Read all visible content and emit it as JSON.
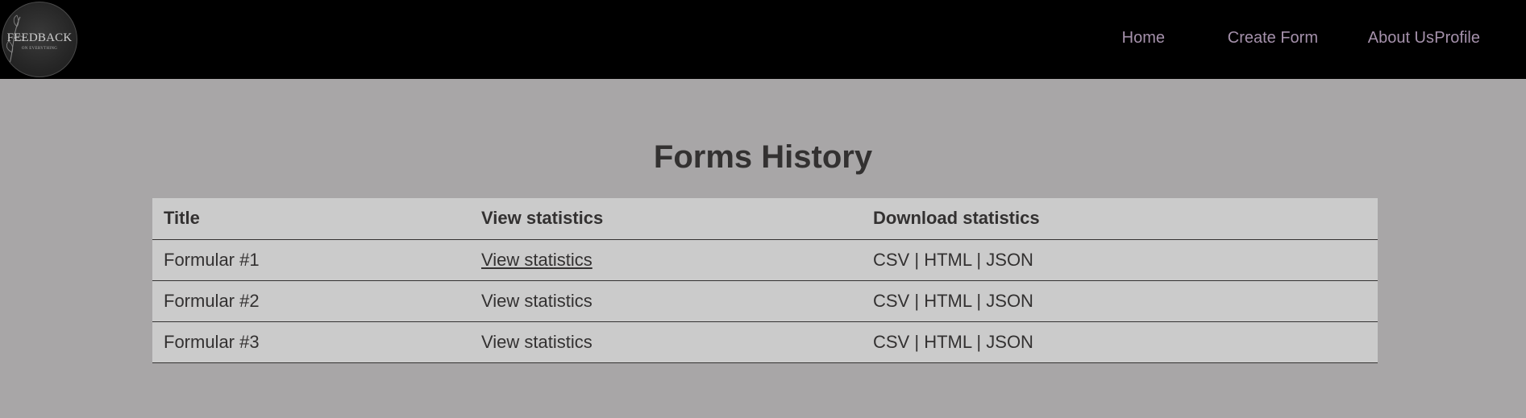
{
  "header": {
    "logo": {
      "title": "FEEDBACK",
      "subtitle": "ON EVERYTHING"
    },
    "nav": [
      {
        "label": "Home"
      },
      {
        "label": "Create Form"
      },
      {
        "label": "About Us"
      },
      {
        "label": "Profile"
      }
    ],
    "nav_color": "#a591ab",
    "background_color": "#000000"
  },
  "main": {
    "title": "Forms History",
    "background_color": "#a8a6a7",
    "table": {
      "columns": [
        "Title",
        "View statistics",
        "Download statistics"
      ],
      "rows": [
        {
          "title": "Formular #1",
          "view": "View statistics",
          "csv": "CSV",
          "html": "HTML",
          "json": "JSON"
        },
        {
          "title": "Formular #2",
          "view": "View statistics",
          "csv": "CSV",
          "html": "HTML",
          "json": "JSON"
        },
        {
          "title": "Formular #3",
          "view": "View statistics",
          "csv": "CSV",
          "html": "HTML",
          "json": "JSON"
        }
      ],
      "separator": "|"
    }
  }
}
